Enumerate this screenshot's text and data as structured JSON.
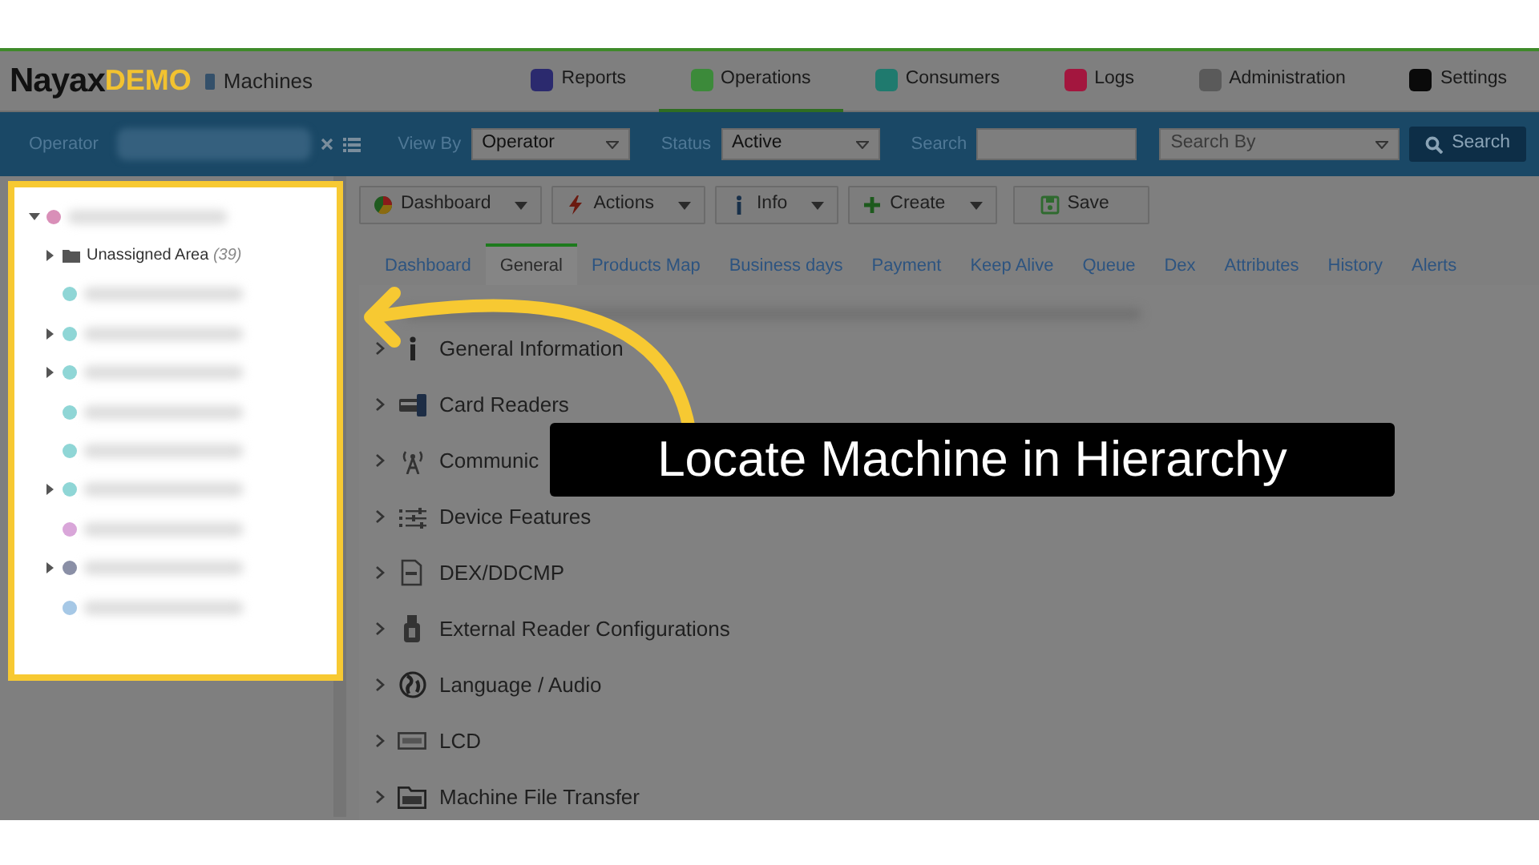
{
  "header": {
    "logo": "Nayax",
    "logo_suffix": "DEMO",
    "page": "Machines",
    "nav": [
      {
        "label": "Reports",
        "color": "#2b2a6e",
        "selected": false
      },
      {
        "label": "Operations",
        "color": "#3c8a3a",
        "selected": true
      },
      {
        "label": "Consumers",
        "color": "#1f7a6e",
        "selected": false
      },
      {
        "label": "Logs",
        "color": "#a3163e",
        "selected": false
      },
      {
        "label": "Administration",
        "color": "#5a5a5a",
        "selected": false
      },
      {
        "label": "Settings",
        "color": "#0a0a0a",
        "selected": false
      }
    ]
  },
  "filter_bar": {
    "operator_label": "Operator",
    "view_by_label": "View By",
    "view_by": "Operator",
    "status_label": "Status",
    "status": "Active",
    "search_label": "Search",
    "search_by_placeholder": "Search By",
    "search_button": "Search"
  },
  "tree": {
    "kind": "redacted",
    "color": "#d98fb8",
    "expanded": true,
    "children": [
      {
        "kind": "folder",
        "label": "Unassigned Area",
        "count": "(39)",
        "expanded": false
      },
      {
        "kind": "redacted",
        "color": "#8fd6d6"
      },
      {
        "kind": "redacted",
        "color": "#8fd6d6",
        "expanded": false
      },
      {
        "kind": "redacted",
        "color": "#8fd6d6",
        "expanded": false
      },
      {
        "kind": "redacted",
        "color": "#8fd6d6"
      },
      {
        "kind": "redacted",
        "color": "#8fd6d6"
      },
      {
        "kind": "redacted",
        "color": "#8fd6d6",
        "expanded": false
      },
      {
        "kind": "redacted",
        "color": "#d9a6d9"
      },
      {
        "kind": "redacted",
        "color": "#8a8fa6",
        "expanded": false
      },
      {
        "kind": "redacted",
        "color": "#a6c8e6"
      }
    ]
  },
  "toolbar": [
    {
      "label": "Dashboard",
      "kind": "pie",
      "dropdown": true
    },
    {
      "label": "Actions",
      "kind": "bolt",
      "dropdown": true
    },
    {
      "label": "Info",
      "kind": "info",
      "dropdown": true
    },
    {
      "label": "Create",
      "kind": "plus",
      "dropdown": true
    },
    {
      "label": "Save",
      "kind": "disk",
      "dropdown": false
    }
  ],
  "tabs": [
    {
      "label": "Dashboard",
      "selected": false
    },
    {
      "label": "General",
      "selected": true
    },
    {
      "label": "Products Map",
      "selected": false
    },
    {
      "label": "Business days",
      "selected": false
    },
    {
      "label": "Payment",
      "selected": false
    },
    {
      "label": "Keep Alive",
      "selected": false
    },
    {
      "label": "Queue",
      "selected": false
    },
    {
      "label": "Dex",
      "selected": false
    },
    {
      "label": "Attributes",
      "selected": false
    },
    {
      "label": "History",
      "selected": false
    },
    {
      "label": "Alerts",
      "selected": false
    }
  ],
  "sections": [
    {
      "label": "General Information",
      "kind": "info"
    },
    {
      "label": "Card Readers",
      "kind": "card"
    },
    {
      "label": "Communic",
      "kind": "antenna"
    },
    {
      "label": "Device Features",
      "kind": "sliders"
    },
    {
      "label": "DEX/DDCMP",
      "kind": "document"
    },
    {
      "label": "External Reader Configurations",
      "kind": "usb"
    },
    {
      "label": "Language / Audio",
      "kind": "globe"
    },
    {
      "label": "LCD",
      "kind": "screen"
    },
    {
      "label": "Machine File Transfer",
      "kind": "folder"
    }
  ],
  "callout": {
    "text": "Locate Machine in Hierarchy"
  }
}
